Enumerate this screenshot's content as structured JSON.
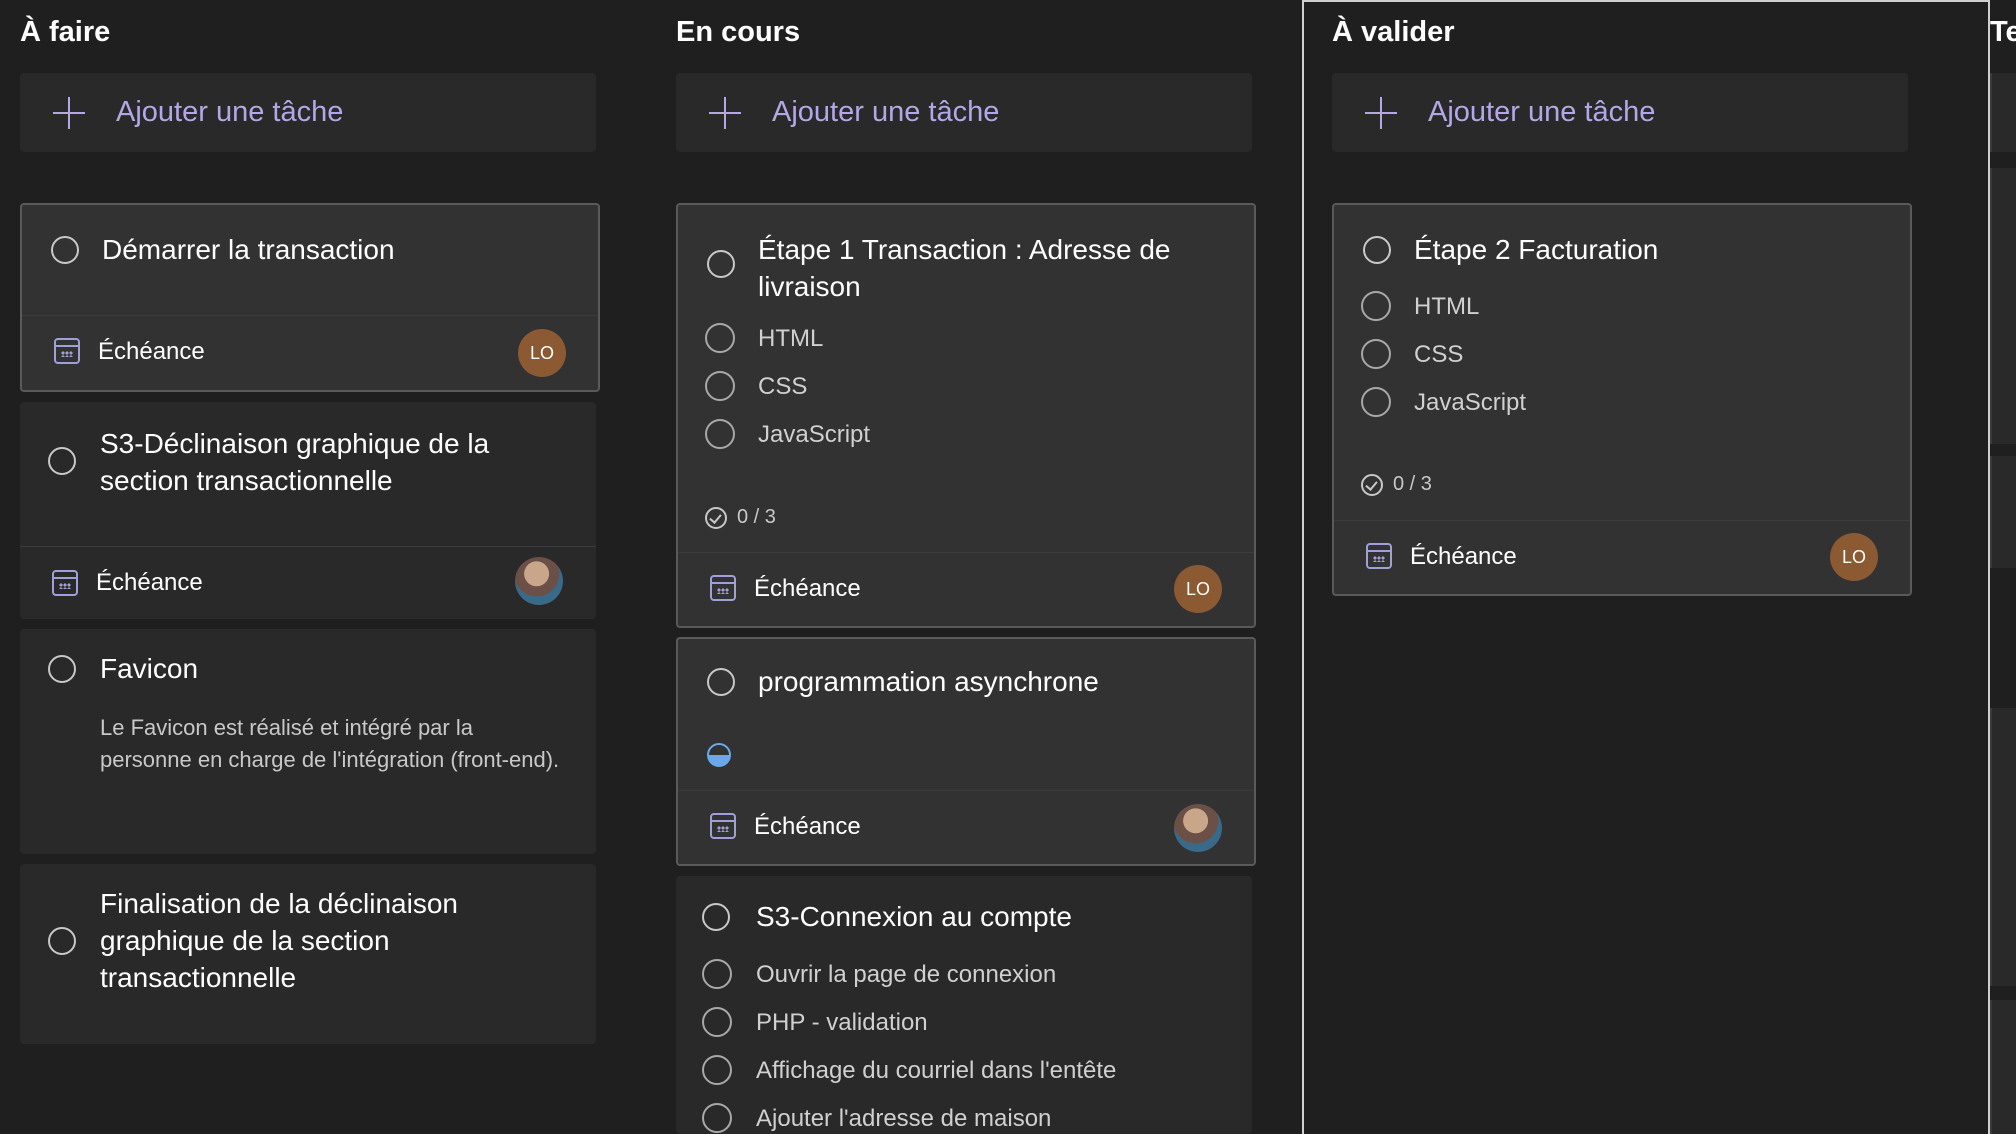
{
  "columns": [
    {
      "title": "À faire",
      "add_label": "Ajouter une tâche",
      "cards": [
        {
          "title": "Démarrer la transaction",
          "due": "Échéance",
          "assignee": "LO"
        },
        {
          "title": "S3-Déclinaison graphique de la section transactionnelle",
          "due": "Échéance",
          "assignee": "photo"
        },
        {
          "title": "Favicon",
          "description": "Le Favicon est réalisé et intégré par la personne en charge de l'intégration (front-end)."
        },
        {
          "title": "Finalisation de la déclinaison graphique de la section transactionnelle"
        }
      ]
    },
    {
      "title": "En cours",
      "add_label": "Ajouter une tâche",
      "cards": [
        {
          "title": "Étape 1 Transaction : Adresse de livraison",
          "checklist": [
            "HTML",
            "CSS",
            "JavaScript"
          ],
          "progress": "0 / 3",
          "due": "Échéance",
          "assignee": "LO"
        },
        {
          "title": "programmation asynchrone",
          "status": "in-progress-half",
          "due": "Échéance",
          "assignee": "photo"
        },
        {
          "title": "S3-Connexion au compte",
          "checklist": [
            "Ouvrir la page de connexion",
            "PHP - validation",
            "Affichage du courriel dans l'entête",
            "Ajouter l'adresse de maison"
          ]
        }
      ]
    },
    {
      "title": "À valider",
      "add_label": "Ajouter une tâche",
      "cards": [
        {
          "title": "Étape 2 Facturation",
          "checklist": [
            "HTML",
            "CSS",
            "JavaScript"
          ],
          "progress": "0 / 3",
          "due": "Échéance",
          "assignee": "LO"
        }
      ]
    },
    {
      "title": "Te"
    }
  ],
  "colors": {
    "accent": "#b4a7e6",
    "avatar": "#8b5a33",
    "background": "#1f1f1f",
    "card": "#292929"
  }
}
